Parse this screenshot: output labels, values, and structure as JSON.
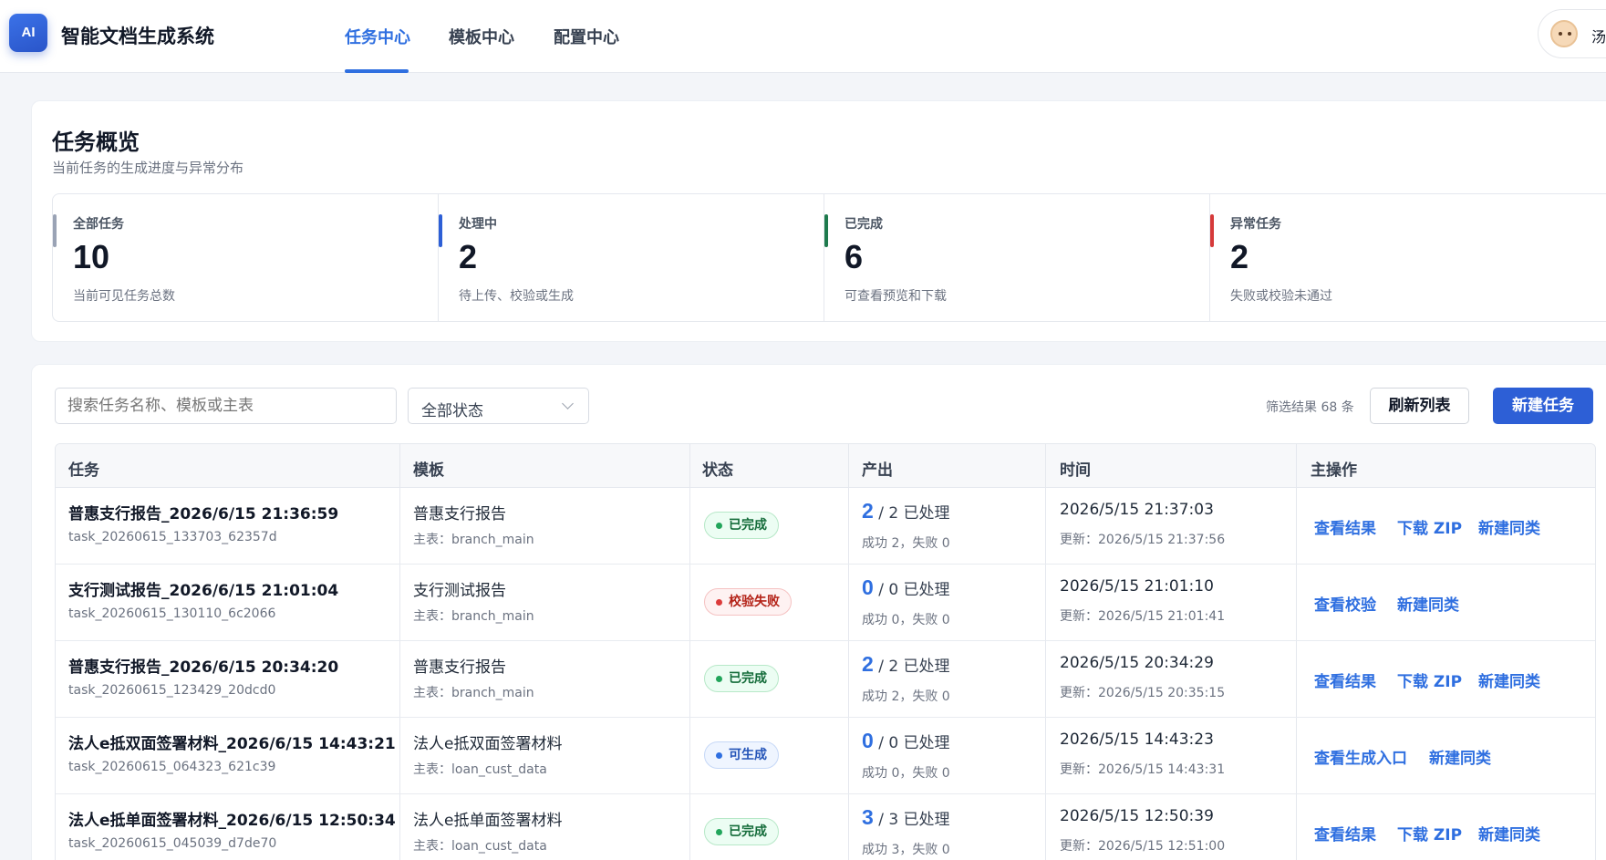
{
  "header": {
    "logo_text": "AI",
    "app_title": "智能文档生成系统",
    "tabs": [
      "任务中心",
      "模板中心",
      "配置中心"
    ],
    "active_tab": "任务中心",
    "user_name": "汤"
  },
  "overview": {
    "title": "任务概览",
    "subtitle": "当前任务的生成进度与异常分布",
    "stats": [
      {
        "label": "全部任务",
        "value": "10",
        "desc": "当前可见任务总数",
        "color": "#9aa3b5"
      },
      {
        "label": "处理中",
        "value": "2",
        "desc": "待上传、校验或生成",
        "color": "#2d5fd6"
      },
      {
        "label": "已完成",
        "value": "6",
        "desc": "可查看预览和下载",
        "color": "#1e7a4d"
      },
      {
        "label": "异常任务",
        "value": "2",
        "desc": "失败或校验未通过",
        "color": "#d63a3a"
      }
    ]
  },
  "toolbar": {
    "search_placeholder": "搜索任务名称、模板或主表",
    "status_select": "全部状态",
    "filter_count": "筛选结果 68 条",
    "refresh_label": "刷新列表",
    "new_task_label": "新建任务"
  },
  "table": {
    "columns": [
      "任务",
      "模板",
      "状态",
      "产出",
      "时间",
      "主操作"
    ],
    "rows": [
      {
        "name": "普惠支行报告_2026/6/15 21:36:59",
        "id": "task_20260615_133703_62357d",
        "template": "普惠支行报告",
        "main_table": "主表：branch_main",
        "status": "已完成",
        "out_done": "2",
        "out_rest": " / 2 已处理",
        "out_detail": "成功 2，失败 0",
        "time": "2026/5/15 21:37:03",
        "updated": "更新：2026/5/15 21:37:56",
        "actions": [
          "查看结果",
          "下载 ZIP",
          "新建同类"
        ]
      },
      {
        "name": "支行测试报告_2026/6/15 21:01:04",
        "id": "task_20260615_130110_6c2066",
        "template": "支行测试报告",
        "main_table": "主表：branch_main",
        "status": "校验失败",
        "out_done": "0",
        "out_rest": " / 0 已处理",
        "out_detail": "成功 0，失败 0",
        "time": "2026/5/15 21:01:10",
        "updated": "更新：2026/5/15 21:01:41",
        "actions": [
          "查看校验",
          "新建同类"
        ]
      },
      {
        "name": "普惠支行报告_2026/6/15 20:34:20",
        "id": "task_20260615_123429_20dcd0",
        "template": "普惠支行报告",
        "main_table": "主表：branch_main",
        "status": "已完成",
        "out_done": "2",
        "out_rest": " / 2 已处理",
        "out_detail": "成功 2，失败 0",
        "time": "2026/5/15 20:34:29",
        "updated": "更新：2026/5/15 20:35:15",
        "actions": [
          "查看结果",
          "下载 ZIP",
          "新建同类"
        ]
      },
      {
        "name": "法人e抵双面签署材料_2026/6/15 14:43:21",
        "id": "task_20260615_064323_621c39",
        "template": "法人e抵双面签署材料",
        "main_table": "主表：loan_cust_data",
        "status": "可生成",
        "out_done": "0",
        "out_rest": " / 0 已处理",
        "out_detail": "成功 0，失败 0",
        "time": "2026/5/15 14:43:23",
        "updated": "更新：2026/5/15 14:43:31",
        "actions": [
          "查看生成入口",
          "新建同类"
        ]
      },
      {
        "name": "法人e抵单面签署材料_2026/6/15 12:50:34",
        "id": "task_20260615_045039_d7de70",
        "template": "法人e抵单面签署材料",
        "main_table": "主表：loan_cust_data",
        "status": "已完成",
        "out_done": "3",
        "out_rest": " / 3 已处理",
        "out_detail": "成功 3，失败 0",
        "time": "2026/5/15 12:50:39",
        "updated": "更新：2026/5/15 12:51:00",
        "actions": [
          "查看结果",
          "下载 ZIP",
          "新建同类"
        ]
      }
    ]
  }
}
